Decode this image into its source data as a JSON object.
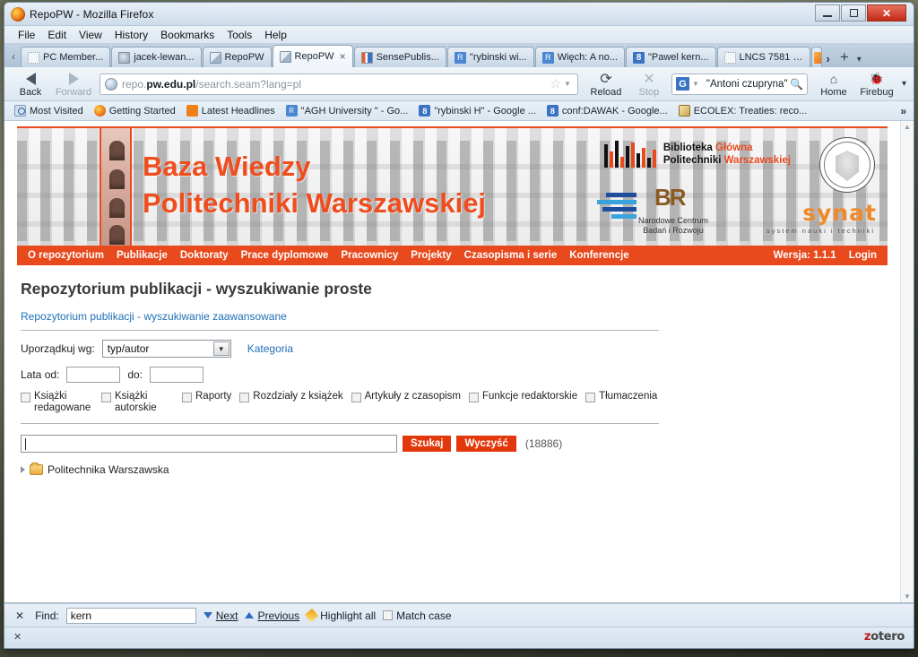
{
  "window": {
    "title": "RepoPW - Mozilla Firefox",
    "controls": {
      "minimize": "–",
      "maximize": "□",
      "close": "✕"
    }
  },
  "menubar": [
    {
      "label": "File"
    },
    {
      "label": "Edit"
    },
    {
      "label": "View"
    },
    {
      "label": "History"
    },
    {
      "label": "Bookmarks"
    },
    {
      "label": "Tools"
    },
    {
      "label": "Help"
    }
  ],
  "tabs": {
    "scroll_left": "‹",
    "scroll_right": "›",
    "new_tab": "+",
    "list_all": "▾",
    "close_glyph": "×",
    "items": [
      {
        "label": "PC Member...",
        "icon": "dotted-page-icon",
        "active": false
      },
      {
        "label": "jacek-lewan...",
        "icon": "page-icon",
        "active": false
      },
      {
        "label": "RepoPW",
        "icon": "book-icon",
        "active": false
      },
      {
        "label": "RepoPW",
        "icon": "book-icon",
        "active": true
      },
      {
        "label": "SensePublis...",
        "icon": "sensepublishers-icon",
        "active": false
      },
      {
        "label": "\"rybinski wi...",
        "icon": "researchgate-icon",
        "active": false
      },
      {
        "label": "Więch: A no...",
        "icon": "researchgate-icon",
        "active": false
      },
      {
        "label": "\"Pawel kern...",
        "icon": "google-scholar-icon",
        "active": false
      },
      {
        "label": "LNCS 7581 -...",
        "icon": "dotted-page-icon",
        "active": false
      }
    ]
  },
  "toolbar": {
    "back_label": "Back",
    "forward_label": "Forward",
    "reload_label": "Reload",
    "stop_label": "Stop",
    "home_label": "Home",
    "firebug_label": "Firebug",
    "overflow_chevron": "▾",
    "url": {
      "prefix": "repo.",
      "domain": "pw.edu.pl",
      "path": "/search.seam?lang=pl"
    },
    "bookmark_star": "☆",
    "search": {
      "engine": "G",
      "engine_name": "google-search-engine",
      "value": "\"Antoni czupryna\"",
      "placeholder": "Search"
    }
  },
  "bookmarks": {
    "overflow": "»",
    "items": [
      {
        "label": "Most Visited",
        "icon": "search-history-icon"
      },
      {
        "label": "Getting Started",
        "icon": "firefox-icon"
      },
      {
        "label": "Latest Headlines",
        "icon": "rss-icon"
      },
      {
        "label": "\"AGH University \" - Go...",
        "icon": "researchgate-icon"
      },
      {
        "label": "\"rybinski H\" - Google ...",
        "icon": "google-scholar-icon"
      },
      {
        "label": "conf:DAWAK - Google...",
        "icon": "google-scholar-icon"
      },
      {
        "label": "ECOLEX: Treaties: reco...",
        "icon": "ecolex-icon"
      }
    ]
  },
  "page": {
    "hero": {
      "title_line1": "Baza Wiedzy",
      "title_line2": "Politechniki Warszawskiej",
      "library_line1_a": "Biblioteka ",
      "library_line1_b": "Główna",
      "library_line2_a": "Politechniki ",
      "library_line2_b": "Warszawskiej",
      "ncbr_line1": "Narodowe Centrum",
      "ncbr_line2": "Badań i Rozwoju",
      "br_logo": "BR",
      "synat": "synat",
      "synat_sub": "system nauki i techniki",
      "seal_alt": "politechnika-warszawska-seal"
    },
    "sitenav": {
      "items": [
        {
          "label": "O repozytorium"
        },
        {
          "label": "Publikacje"
        },
        {
          "label": "Doktoraty"
        },
        {
          "label": "Prace dyplomowe"
        },
        {
          "label": "Pracownicy"
        },
        {
          "label": "Projekty"
        },
        {
          "label": "Czasopisma i serie"
        },
        {
          "label": "Konferencje"
        }
      ],
      "version": "Wersja: 1.1.1",
      "login": "Login"
    },
    "title": "Repozytorium publikacji - wyszukiwanie proste",
    "advanced_link": "Repozytorium publikacji - wyszukiwanie zaawansowane",
    "sort": {
      "label": "Uporządkuj wg:",
      "value": "typ/autor",
      "arrow": "▼",
      "category_link": "Kategoria"
    },
    "years": {
      "from_label": "Lata od:",
      "from_value": "",
      "to_label": "do:",
      "to_value": ""
    },
    "filters": [
      {
        "label": "Książki redagowane",
        "checked": false
      },
      {
        "label": "Książki autorskie",
        "checked": false
      },
      {
        "label": "Raporty",
        "checked": false
      },
      {
        "label": "Rozdziały z książek",
        "checked": false
      },
      {
        "label": "Artykuły z czasopism",
        "checked": false
      },
      {
        "label": "Funkcje redaktorskie",
        "checked": false
      },
      {
        "label": "Tłumaczenia",
        "checked": false
      }
    ],
    "search": {
      "value": "",
      "placeholder": "",
      "submit_label": "Szukaj",
      "clear_label": "Wyczyść",
      "result_count": "(18886)"
    },
    "tree": {
      "expander": "▸",
      "root_label": "Politechnika Warszawska"
    }
  },
  "findbar": {
    "close": "✕",
    "label": "Find:",
    "value": "kern",
    "next": "Next",
    "previous": "Previous",
    "highlight_all": "Highlight all",
    "match_case": "Match case"
  },
  "statusbar": {
    "close": "✕",
    "zotero_z": "z",
    "zotero_rest": "otero"
  },
  "colors": {
    "accent_orange": "#e8491d",
    "button_red": "#e2380b",
    "link_blue": "#1f6fb5"
  }
}
